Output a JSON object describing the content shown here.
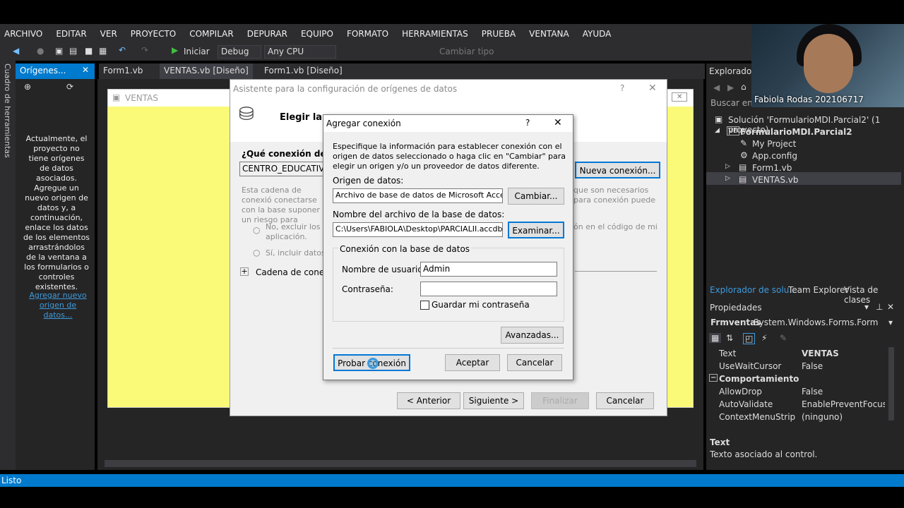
{
  "menu": [
    "ARCHIVO",
    "EDITAR",
    "VER",
    "PROYECTO",
    "COMPILAR",
    "DEPURAR",
    "EQUIPO",
    "FORMATO",
    "HERRAMIENTAS",
    "PRUEBA",
    "VENTANA",
    "AYUDA"
  ],
  "toolbar": {
    "start_label": "Iniciar",
    "config": "Debug",
    "platform": "Any CPU",
    "change_type": "Cambiar tipo"
  },
  "tabs": {
    "origins": "Orígenes...",
    "form1": "Form1.vb",
    "ventas": "VENTAS.vb [Diseño]",
    "form1_design": "Form1.vb [Diseño]"
  },
  "left": {
    "toolbox_vertical": "Cuadro de herramientas",
    "message": "Actualmente, el proyecto no tiene orígenes de datos asociados. Agregue un nuevo origen de datos y, a continuación, enlace los datos de los elementos arrastrándolos de la ventana a los formularios o controles existentes.",
    "link": "Agregar nuevo origen de datos..."
  },
  "form": {
    "title": "VENTAS"
  },
  "wizard": {
    "title": "Asistente para la configuración de orígenes de datos",
    "heading": "Elegir la c",
    "question": "¿Qué conexión de dato",
    "connection_value": "CENTRO_EDUCATIVO.m",
    "new_connection": "Nueva conexión...",
    "desc_left": "Esta cadena de conexió conectarse con la base suponer un riesgo para",
    "desc_right": "que son necesarios para conexión puede",
    "radio_no": "No, excluir los aplicación.",
    "radio_no_right": "ón en el código de mi",
    "radio_si": "Sí, incluir datos c",
    "connstring": "Cadena de conexión",
    "back": "< Anterior",
    "next": "Siguiente >",
    "finish": "Finalizar",
    "cancel": "Cancelar",
    "help": "?"
  },
  "dialog": {
    "title": "Agregar conexión",
    "help": "?",
    "intro": "Especifique la información para establecer conexión con el origen de datos seleccionado o haga clic en \"Cambiar\" para elegir un origen y/o un proveedor de datos diferente.",
    "source_label": "Origen de datos:",
    "source_value": "Archivo de base de datos de Microsoft Access (O",
    "change": "Cambiar...",
    "file_label": "Nombre del archivo de la base de datos:",
    "file_value": "C:\\Users\\FABIOLA\\Desktop\\PARCIALII.accdb",
    "browse": "Examinar...",
    "group": "Conexión con la base de datos",
    "user_label": "Nombre de usuario:",
    "user_value": "Admin",
    "pass_label": "Contraseña:",
    "pass_value": "",
    "save_pass": "Guardar mi contraseña",
    "advanced": "Avanzadas...",
    "test": "Probar conexión",
    "ok": "Aceptar",
    "cancel": "Cancelar"
  },
  "explorer": {
    "title": "Explorador c",
    "search": "Buscar en el",
    "solution": "Solución 'FormularioMDI.Parcial2' (1 proyecto)",
    "project": "FormularioMDI.Parcial2",
    "items": [
      "My Project",
      "App.config",
      "Form1.vb",
      "VENTAS.vb"
    ],
    "bottom_tabs": [
      "Explorador de solu...",
      "Team Explorer",
      "Vista de clases"
    ]
  },
  "webcam": {
    "caption": "Fabiola Rodas 202106717"
  },
  "properties": {
    "title": "Propiedades",
    "object": "Frmventas",
    "object_type": "System.Windows.Forms.Form",
    "rows": [
      {
        "k": "Text",
        "v": "VENTAS"
      },
      {
        "k": "UseWaitCursor",
        "v": "False"
      }
    ],
    "category": "Comportamiento",
    "rows2": [
      {
        "k": "AllowDrop",
        "v": "False"
      },
      {
        "k": "AutoValidate",
        "v": "EnablePreventFocusCha"
      },
      {
        "k": "ContextMenuStrip",
        "v": "(ninguno)"
      }
    ],
    "desc_title": "Text",
    "desc": "Texto asociado al control."
  },
  "status": "Listo"
}
